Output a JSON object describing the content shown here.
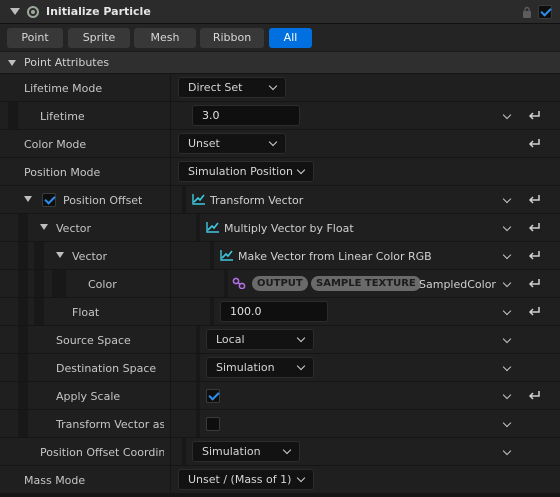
{
  "header": {
    "title": "Initialize Particle",
    "enabled": true
  },
  "tabs": [
    {
      "label": "Point",
      "active": false
    },
    {
      "label": "Sprite",
      "active": false
    },
    {
      "label": "Mesh",
      "active": false
    },
    {
      "label": "Ribbon",
      "active": false
    },
    {
      "label": "All",
      "active": true
    }
  ],
  "section": {
    "title": "Point Attributes"
  },
  "rows": {
    "lifetime_mode": {
      "label": "Lifetime Mode",
      "value": "Direct Set"
    },
    "lifetime": {
      "label": "Lifetime",
      "value": "3.0"
    },
    "color_mode": {
      "label": "Color Mode",
      "value": "Unset"
    },
    "position_mode": {
      "label": "Position Mode",
      "value": "Simulation Position"
    },
    "position_offset": {
      "label": "Position Offset",
      "value": "Transform Vector",
      "checked": true
    },
    "vector1": {
      "label": "Vector",
      "value": "Multiply Vector by Float"
    },
    "vector2": {
      "label": "Vector",
      "value": "Make Vector from Linear Color RGB"
    },
    "color": {
      "label": "Color",
      "pill1": "OUTPUT",
      "pill2": "SAMPLE TEXTURE",
      "value": "SampledColor"
    },
    "float": {
      "label": "Float",
      "value": "100.0"
    },
    "source_space": {
      "label": "Source Space",
      "value": "Local"
    },
    "destination_space": {
      "label": "Destination Space",
      "value": "Simulation"
    },
    "apply_scale": {
      "label": "Apply Scale",
      "checked": true
    },
    "transform_vector_as": {
      "label": "Transform Vector as",
      "checked": false
    },
    "position_offset_coordinate": {
      "label": "Position Offset Coordina",
      "value": "Simulation"
    },
    "mass_mode": {
      "label": "Mass Mode",
      "value": "Unset / (Mass of 1)"
    }
  },
  "colors": {
    "accent": "#0070e0",
    "dynamic_input_icon": "#3fc8e0",
    "link_icon": "#b46ee6",
    "pill": "#6a6a6a"
  },
  "icons": [
    "collapse-triangle-icon",
    "enable-circle-icon",
    "lock-icon",
    "checkbox-icon",
    "chevron-down-icon",
    "reset-arrow-icon",
    "graph-icon",
    "link-icon"
  ]
}
